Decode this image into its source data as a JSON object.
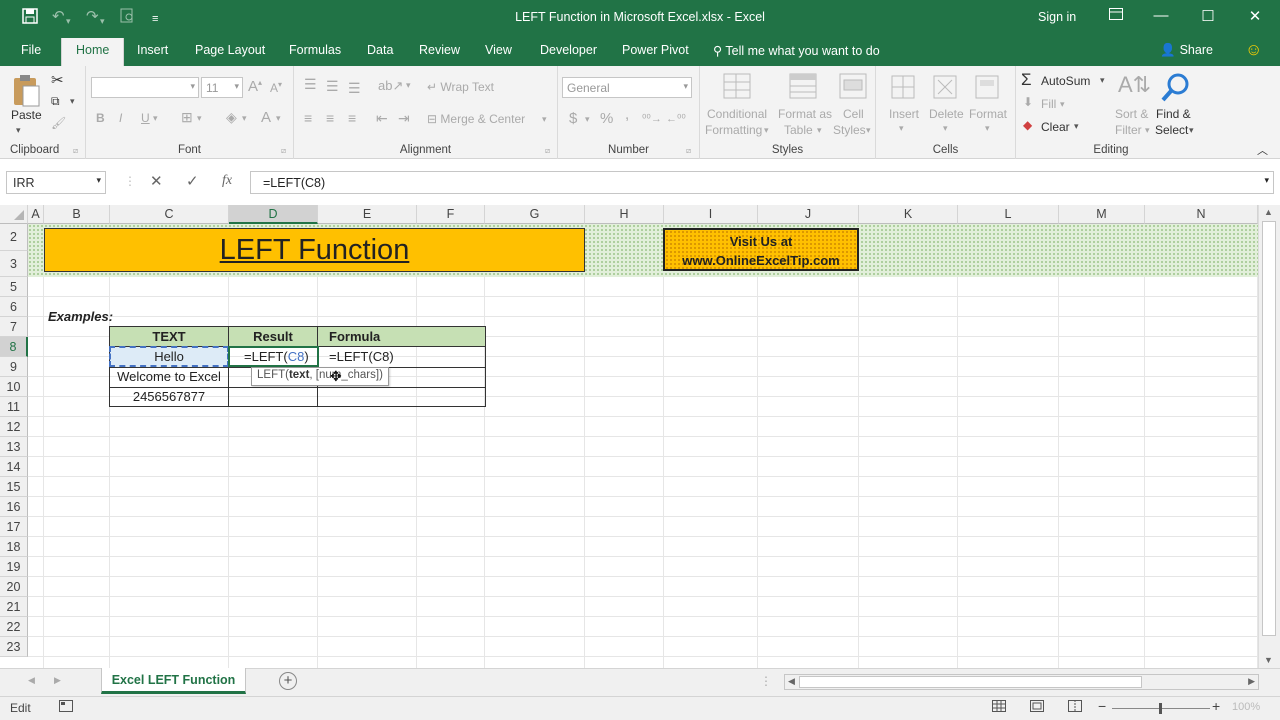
{
  "window": {
    "title": "LEFT Function in Microsoft Excel.xlsx - Excel",
    "sign_in": "Sign in",
    "share": "Share"
  },
  "tabs": [
    "File",
    "Home",
    "Insert",
    "Page Layout",
    "Formulas",
    "Data",
    "Review",
    "View",
    "Developer",
    "Power Pivot"
  ],
  "active_tab": "Home",
  "tell_me": "Tell me what you want to do",
  "ribbon": {
    "clipboard": {
      "label": "Clipboard",
      "paste": "Paste"
    },
    "font": {
      "label": "Font",
      "font_name": "",
      "font_size": "11",
      "bold": "B",
      "italic": "I",
      "underline": "U"
    },
    "alignment": {
      "label": "Alignment",
      "wrap": "Wrap Text",
      "merge": "Merge & Center"
    },
    "number": {
      "label": "Number",
      "format": "General",
      "currency": "$",
      "percent": "%",
      "comma": ","
    },
    "styles": {
      "label": "Styles",
      "cond1": "Conditional",
      "cond2": "Formatting",
      "fmt1": "Format as",
      "fmt2": "Table",
      "cell1": "Cell",
      "cell2": "Styles"
    },
    "cells": {
      "label": "Cells",
      "insert": "Insert",
      "delete": "Delete",
      "format": "Format"
    },
    "editing": {
      "label": "Editing",
      "autosum": "AutoSum",
      "fill": "Fill",
      "clear": "Clear",
      "sort1": "Sort &",
      "sort2": "Filter",
      "find1": "Find &",
      "find2": "Select"
    }
  },
  "formula_bar": {
    "name_box": "IRR",
    "fx": "fx",
    "formula": "=LEFT(C8)"
  },
  "columns": [
    "A",
    "B",
    "C",
    "D",
    "E",
    "F",
    "G",
    "H",
    "I",
    "J",
    "K",
    "L",
    "M",
    "N"
  ],
  "rows": [
    "2",
    "3",
    "5",
    "6",
    "7",
    "8",
    "9",
    "10",
    "11",
    "12",
    "13",
    "14",
    "15",
    "16",
    "17",
    "18",
    "19",
    "20",
    "21",
    "22",
    "23"
  ],
  "sheet": {
    "banner_title": "LEFT Function",
    "visit_line1": "Visit Us at",
    "visit_line2": "www.OnlineExcelTip.com",
    "examples_label": "Examples:",
    "table_headers": [
      "TEXT",
      "Result",
      "Formula"
    ],
    "table_rows": [
      {
        "text": "Hello",
        "result_prefix": "=LEFT(",
        "result_ref": "C8",
        "result_suffix": ")",
        "formula": "=LEFT(C8)"
      },
      {
        "text": "Welcome to Excel",
        "result": "",
        "formula": ""
      },
      {
        "text": "2456567877",
        "result": "",
        "formula": ""
      }
    ],
    "tooltip_fn": "LEFT(",
    "tooltip_arg1": "text",
    "tooltip_rest": ", [num_chars])"
  },
  "sheet_tab": "Excel LEFT Function",
  "status": {
    "mode": "Edit",
    "zoom": "100%"
  },
  "colors": {
    "excel_green": "#217346",
    "banner_orange": "#FFC000",
    "table_header_green": "#C6E0B4",
    "selected_cell": "#DDEBF7",
    "dotted_bg": "#E2EFDA"
  }
}
